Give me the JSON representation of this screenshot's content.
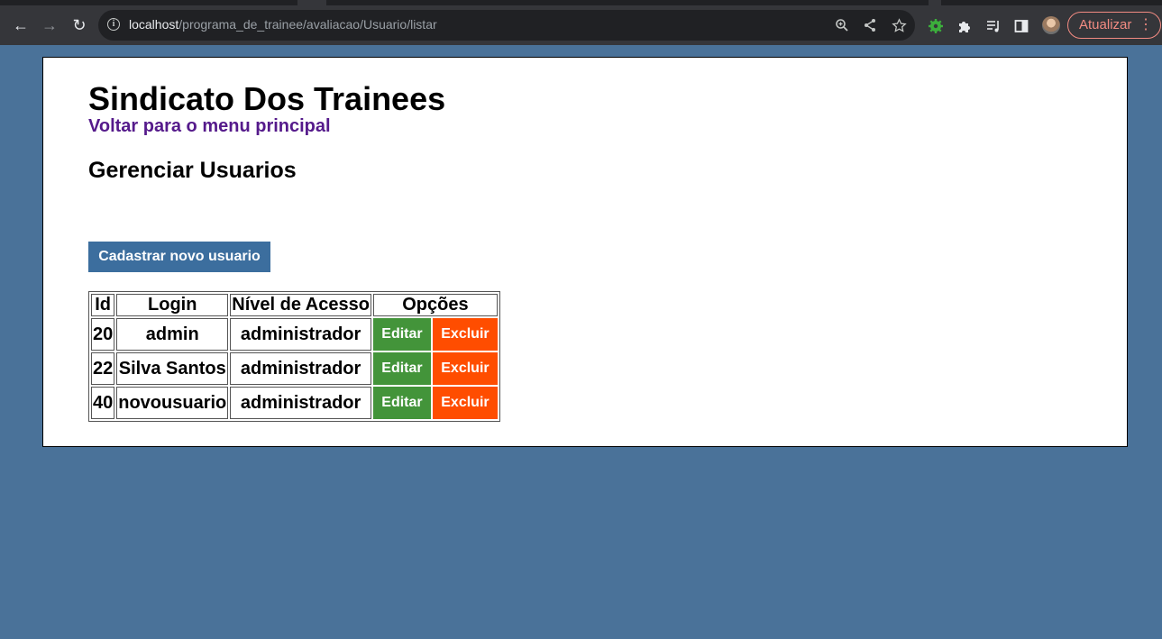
{
  "browser": {
    "url_host": "localhost",
    "url_path": "/programa_de_trainee/avaliacao/Usuario/listar",
    "update_label": "Atualizar"
  },
  "page": {
    "site_title": "Sindicato Dos Trainees",
    "back_link": "Voltar para o menu principal",
    "section_title": "Gerenciar Usuarios",
    "new_user_button": "Cadastrar novo usuario"
  },
  "table": {
    "headers": [
      "Id",
      "Login",
      "Nível de Acesso",
      "Opções"
    ],
    "rows": [
      {
        "id": "20",
        "login": "admin",
        "level": "administrador",
        "edit": "Editar",
        "delete": "Excluir"
      },
      {
        "id": "22",
        "login": "Silva Santos",
        "level": "administrador",
        "edit": "Editar",
        "delete": "Excluir"
      },
      {
        "id": "40",
        "login": "novousuario",
        "level": "administrador",
        "edit": "Editar",
        "delete": "Excluir"
      }
    ]
  },
  "colors": {
    "background": "#4a7299",
    "primary_button": "#3c6e9e",
    "edit_button": "#43943a",
    "delete_button": "#ff4d00",
    "link": "#551a8b"
  }
}
